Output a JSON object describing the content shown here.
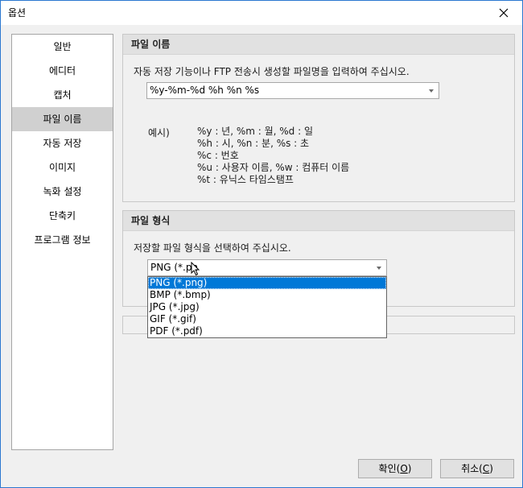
{
  "window": {
    "title": "옵션"
  },
  "sidebar": {
    "items": [
      {
        "label": "일반"
      },
      {
        "label": "에디터"
      },
      {
        "label": "캡처"
      },
      {
        "label": "파일 이름"
      },
      {
        "label": "자동 저장"
      },
      {
        "label": "이미지"
      },
      {
        "label": "녹화 설정"
      },
      {
        "label": "단축키"
      },
      {
        "label": "프로그램 정보"
      }
    ],
    "selected_index": 3
  },
  "filename_panel": {
    "header": "파일 이름",
    "description": "자동 저장 기능이나 FTP 전송시 생성할 파일명을 입력하여 주십시오.",
    "pattern_value": "%y-%m-%d %h %n %s",
    "example_label": "예시)",
    "example_lines": [
      "%y : 년, %m : 월, %d : 일",
      "%h : 시, %n : 분, %s : 초",
      "%c : 번호",
      "%u : 사용자 이름, %w : 컴퓨터 이름",
      "%t : 유닉스 타임스탬프"
    ]
  },
  "format_panel": {
    "header": "파일 형식",
    "description": "저장할 파일 형식을 선택하여 주십시오.",
    "combo_value": "PNG (*.pn",
    "options": [
      "PNG (*.png)",
      "BMP (*.bmp)",
      "JPG (*.jpg)",
      "GIF (*.gif)",
      "PDF (*.pdf)"
    ],
    "highlighted_index": 0
  },
  "buttons": {
    "ok_label": "확인(",
    "ok_key": "O",
    "ok_end": ")",
    "cancel_label": "취소(",
    "cancel_key": "C",
    "cancel_end": ")"
  },
  "colors": {
    "selection_blue": "#0078d7",
    "window_border": "#2b78d0",
    "sidebar_selected": "#d0d0d0"
  }
}
